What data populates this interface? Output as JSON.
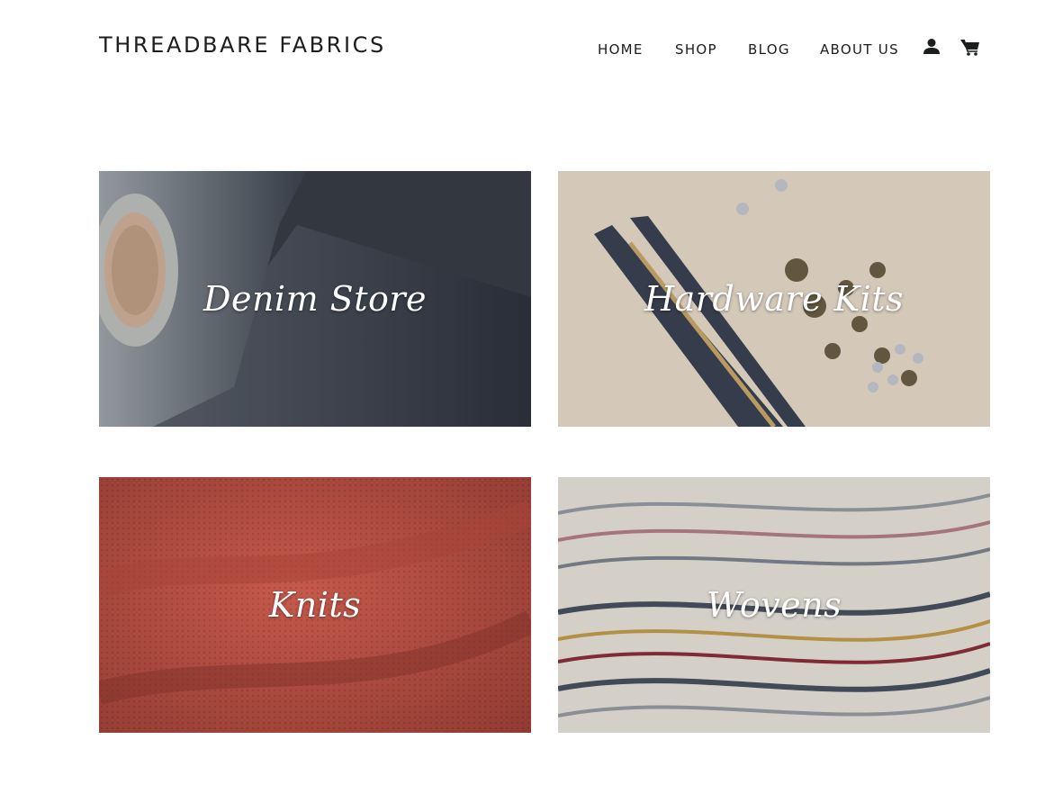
{
  "header": {
    "logo": "THREADBARE FABRICS",
    "nav": {
      "home": "HOME",
      "shop": "SHOP",
      "blog": "BLOG",
      "about": "ABOUT US"
    },
    "icons": [
      "account-icon",
      "cart-icon"
    ]
  },
  "collections": [
    {
      "title": "Denim Store"
    },
    {
      "title": "Hardware Kits"
    },
    {
      "title": "Knits"
    },
    {
      "title": "Wovens"
    }
  ],
  "colors": {
    "text": "#1c1d1d",
    "background": "#ffffff",
    "overlay_text": "#ffffff"
  }
}
